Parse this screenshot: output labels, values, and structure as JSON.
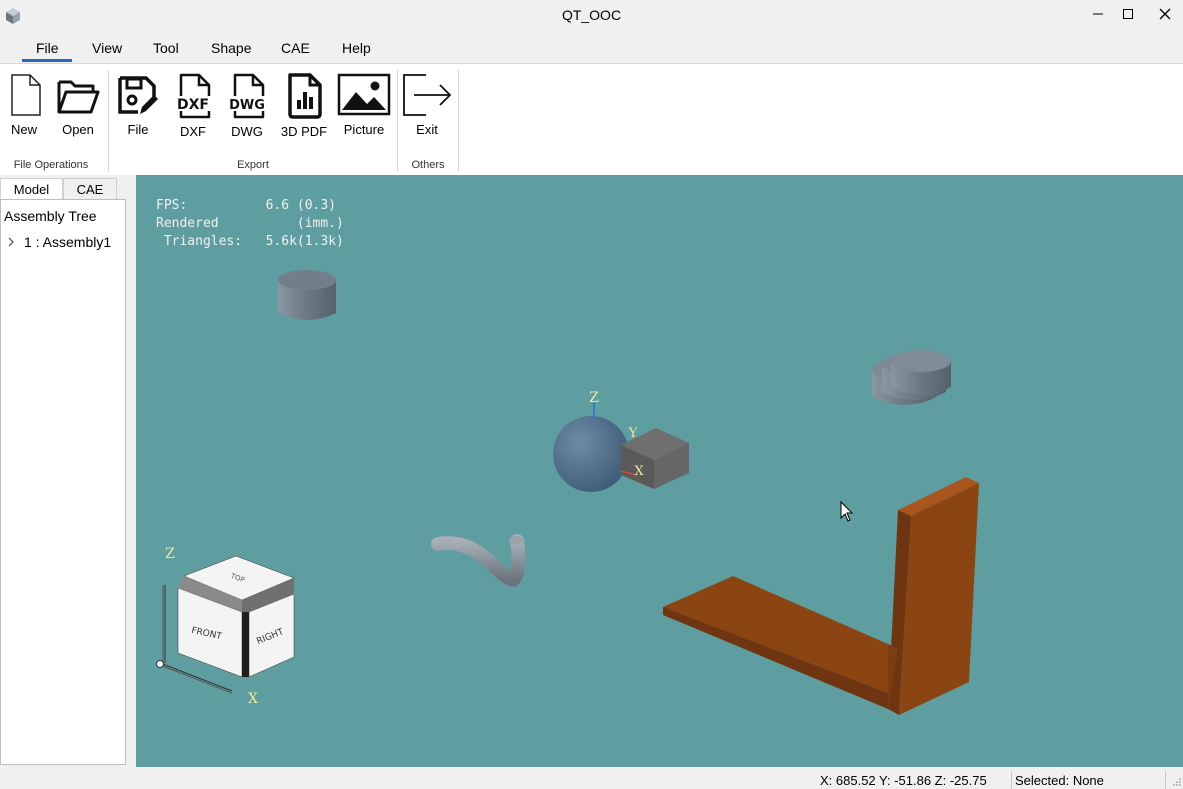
{
  "window": {
    "title": "QT_OOC",
    "minimize_icon": "minimize-icon",
    "maximize_icon": "maximize-icon",
    "close_icon": "close-icon"
  },
  "menu": {
    "items": [
      "File",
      "View",
      "Tool",
      "Shape",
      "CAE",
      "Help"
    ],
    "active": "File"
  },
  "ribbon": {
    "groups": [
      {
        "label": "File Operations",
        "tools": [
          {
            "label": "New",
            "icon": "new-file-icon"
          },
          {
            "label": "Open",
            "icon": "folder-open-icon"
          }
        ]
      },
      {
        "label": "Export",
        "tools": [
          {
            "label": "File",
            "icon": "save-edit-icon"
          },
          {
            "label": "DXF",
            "icon": "dxf-file-icon"
          },
          {
            "label": "DWG",
            "icon": "dwg-file-icon"
          },
          {
            "label": "3D PDF",
            "icon": "pdf-chart-icon"
          },
          {
            "label": "Picture",
            "icon": "picture-icon"
          }
        ]
      },
      {
        "label": "Others",
        "tools": [
          {
            "label": "Exit",
            "icon": "exit-icon"
          }
        ]
      }
    ]
  },
  "left_panel": {
    "tabs": [
      "Model",
      "CAE"
    ],
    "tree_header": "Assembly Tree",
    "tree_items": [
      {
        "label": "1 : Assembly1"
      }
    ]
  },
  "viewport": {
    "background": "#5f9ea0",
    "stats": {
      "fps_label": "FPS:",
      "fps_value": "6.6 (0.3)",
      "rendered_label": "Rendered",
      "rendered_value": "(imm.)",
      "triangles_label": "Triangles:",
      "triangles_value": "5.6k(1.3k)"
    },
    "axis_labels": {
      "z": "Z",
      "x": "X",
      "y": "Y"
    },
    "view_cube": {
      "top": "TOP",
      "front": "FRONT",
      "right": "RIGHT"
    },
    "shape_color_plate": "#8b4513",
    "shape_color_solids": "#6e7b85"
  },
  "status": {
    "coords": "X: 685.52  Y: -51.86  Z: -25.75",
    "selected": "Selected: None"
  }
}
